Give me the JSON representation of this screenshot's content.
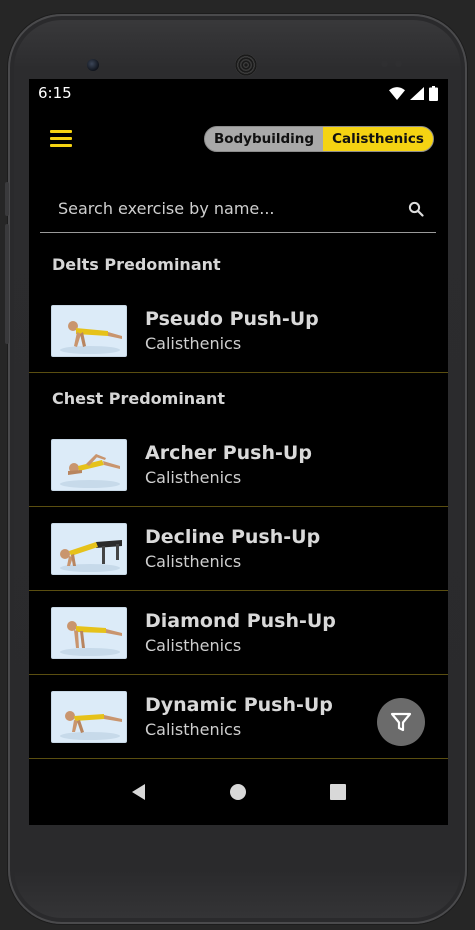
{
  "status": {
    "time": "6:15"
  },
  "toggle": {
    "left_label": "Bodybuilding",
    "right_label": "Calisthenics",
    "selected": "Calisthenics"
  },
  "search": {
    "placeholder": "Search exercise by name...",
    "value": ""
  },
  "sections": [
    {
      "title": "Delts Predominant",
      "items": [
        {
          "name": "Pseudo Push-Up",
          "category": "Calisthenics",
          "icon": "pseudo-push-up-thumbnail"
        }
      ]
    },
    {
      "title": "Chest Predominant",
      "items": [
        {
          "name": "Archer Push-Up",
          "category": "Calisthenics",
          "icon": "archer-push-up-thumbnail"
        },
        {
          "name": "Decline Push-Up",
          "category": "Calisthenics",
          "icon": "decline-push-up-thumbnail"
        },
        {
          "name": "Diamond Push-Up",
          "category": "Calisthenics",
          "icon": "diamond-push-up-thumbnail"
        },
        {
          "name": "Dynamic Push-Up",
          "category": "Calisthenics",
          "icon": "dynamic-push-up-thumbnail"
        }
      ]
    }
  ],
  "colors": {
    "accent": "#f5d312",
    "background": "#000000",
    "divider": "#5a4e10",
    "fab": "#6b6b6b"
  },
  "icons": {
    "menu": "hamburger-menu-icon",
    "search": "search-icon",
    "fab": "filter-icon",
    "nav_back": "back-triangle-icon",
    "nav_home": "home-circle-icon",
    "nav_recents": "recents-square-icon"
  }
}
